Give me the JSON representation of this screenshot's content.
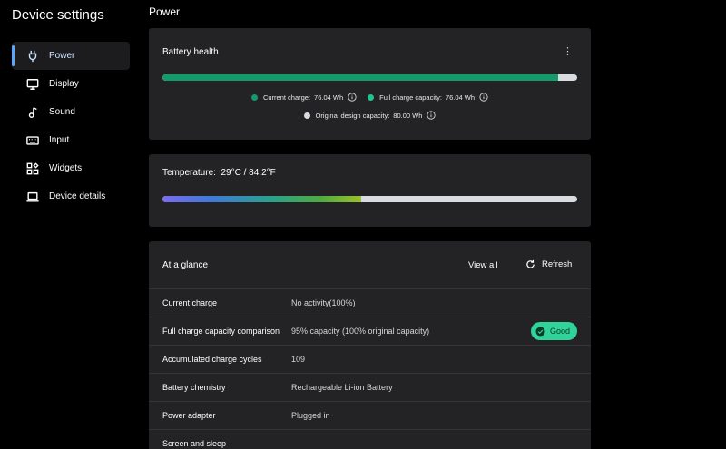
{
  "app": {
    "title": "Device settings"
  },
  "sidebar": {
    "items": [
      {
        "label": "Power",
        "icon": "plug-icon",
        "active": true
      },
      {
        "label": "Display",
        "icon": "monitor-icon",
        "active": false
      },
      {
        "label": "Sound",
        "icon": "music-note-icon",
        "active": false
      },
      {
        "label": "Input",
        "icon": "keyboard-icon",
        "active": false
      },
      {
        "label": "Widgets",
        "icon": "widgets-icon",
        "active": false
      },
      {
        "label": "Device details",
        "icon": "laptop-icon",
        "active": false
      }
    ]
  },
  "page": {
    "title": "Power"
  },
  "battery_health": {
    "title": "Battery health",
    "menu_icon": "kebab-menu-icon",
    "fill_fraction": 0.955,
    "legend": {
      "current_charge": {
        "label": "Current charge:",
        "value": "76.04 Wh",
        "color": "#159a6b"
      },
      "full_charge_capacity": {
        "label": "Full charge capacity:",
        "value": "76.04 Wh",
        "color": "#22c48b"
      },
      "original_design_capacity": {
        "label": "Original design capacity:",
        "value": "80.00 Wh",
        "color": "#d8dbe0"
      }
    }
  },
  "temperature": {
    "label": "Temperature:",
    "value": "29°C / 84.2°F",
    "fill_fraction": 0.48
  },
  "at_a_glance": {
    "title": "At a glance",
    "view_all_label": "View all",
    "refresh_label": "Refresh",
    "rows": [
      {
        "label": "Current charge",
        "value": "No activity(100%)"
      },
      {
        "label": "Full charge capacity comparison",
        "value": "95% capacity (100% original capacity)",
        "badge": "Good"
      },
      {
        "label": "Accumulated charge cycles",
        "value": "109"
      },
      {
        "label": "Battery chemistry",
        "value": "Rechargeable Li-ion Battery"
      },
      {
        "label": "Power adapter",
        "value": "Plugged in"
      },
      {
        "label": "Screen and sleep",
        "value": ""
      }
    ]
  },
  "colors": {
    "background": "#000000",
    "card": "#232325",
    "accent_green": "#159a6b",
    "badge_green": "#30d39a",
    "nav_active_indicator": "#5aa7ff"
  }
}
